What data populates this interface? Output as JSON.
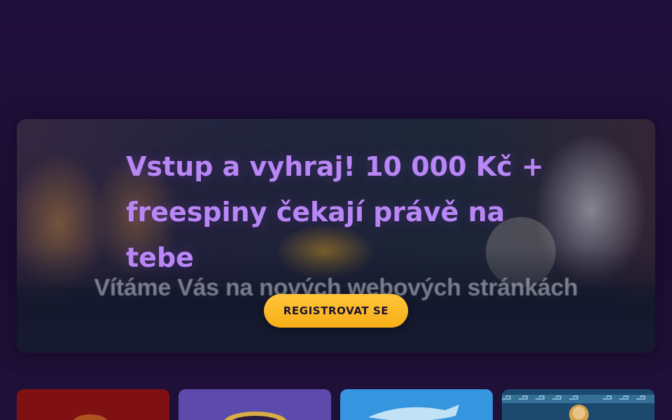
{
  "hero": {
    "headline": "Vstup a vyhraj! 10 000 Kč + freespiny čekají právě na tebe",
    "banner_text": "Vítáme Vás na nových webových stránkách",
    "cta_label": "REGISTROVAT SE"
  },
  "colors": {
    "background": "#1e0f38",
    "headline": "#b886f5",
    "cta": "#f7ae17",
    "cta_text": "#1d1230"
  },
  "game_tiles": [
    {
      "icon": "slot-game-thumbnail-red"
    },
    {
      "icon": "slot-game-thumbnail-purple"
    },
    {
      "icon": "slot-game-thumbnail-shark"
    },
    {
      "icon": "slot-game-thumbnail-greek"
    }
  ]
}
